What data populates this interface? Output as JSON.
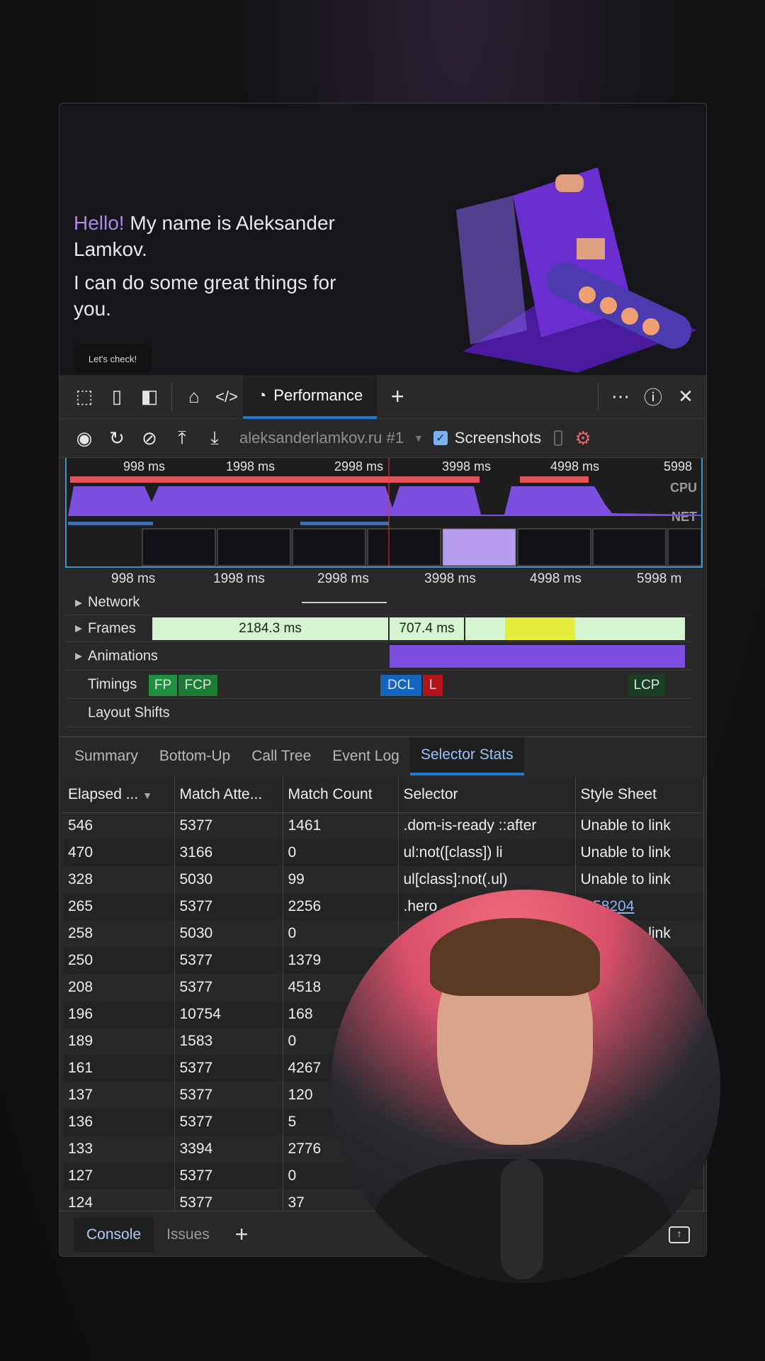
{
  "page": {
    "hello": "Hello!",
    "intro": " My name is Aleksander Lamkov.",
    "tagline": "I can do some great things for you.",
    "cta": "Let's check!"
  },
  "toolbar": {
    "active_tab": "Performance",
    "icons": [
      "inspect-icon",
      "device-icon",
      "dock-icon",
      "home-icon",
      "elements-icon",
      "performance-icon",
      "add-icon",
      "more-icon",
      "help-icon",
      "close-icon"
    ]
  },
  "controls": {
    "profile": "aleksanderlamkov.ru #1",
    "screenshots_label": "Screenshots",
    "screenshots_checked": true
  },
  "overview": {
    "ticks": [
      "998 ms",
      "1998 ms",
      "2998 ms",
      "3998 ms",
      "4998 ms",
      "5998"
    ],
    "cpu_label": "CPU",
    "net_label": "NET"
  },
  "ruler": [
    "998 ms",
    "1998 ms",
    "2998 ms",
    "3998 ms",
    "4998 ms",
    "5998 m"
  ],
  "tracks": {
    "network": "Network",
    "frames": "Frames",
    "frame1": "2184.3 ms",
    "frame2": "707.4 ms",
    "animations": "Animations",
    "timings": "Timings",
    "fp": "FP",
    "fcp": "FCP",
    "dcl": "DCL",
    "l": "L",
    "lcp": "LCP",
    "layout_shifts": "Layout Shifts"
  },
  "tabs": [
    "Summary",
    "Bottom-Up",
    "Call Tree",
    "Event Log",
    "Selector Stats"
  ],
  "table": {
    "headers": [
      "Elapsed ...",
      "Match Atte...",
      "Match Count",
      "Selector",
      "Style Sheet"
    ],
    "rows": [
      [
        "546",
        "5377",
        "1461",
        ".dom-is-ready ::after",
        "Unable to link"
      ],
      [
        "470",
        "3166",
        "0",
        "ul:not([class]) li",
        "Unable to link"
      ],
      [
        "328",
        "5030",
        "99",
        "ul[class]:not(.ul)",
        "Unable to link"
      ],
      [
        "265",
        "5377",
        "2256",
        ".hero",
        "1:58204"
      ],
      [
        "258",
        "5030",
        "0",
        "",
        "Unable to link"
      ],
      [
        "250",
        "5377",
        "1379",
        "",
        "Unable to link"
      ],
      [
        "208",
        "5377",
        "4518",
        "",
        ""
      ],
      [
        "196",
        "10754",
        "168",
        "",
        ""
      ],
      [
        "189",
        "1583",
        "0",
        "",
        ""
      ],
      [
        "161",
        "5377",
        "4267",
        "",
        ""
      ],
      [
        "137",
        "5377",
        "120",
        "",
        ""
      ],
      [
        "136",
        "5377",
        "5",
        "",
        ""
      ],
      [
        "133",
        "3394",
        "2776",
        "",
        ""
      ],
      [
        "127",
        "5377",
        "0",
        "",
        ""
      ],
      [
        "124",
        "5377",
        "37",
        "",
        ""
      ]
    ]
  },
  "drawer": {
    "tabs": [
      "Console",
      "Issues"
    ]
  },
  "colors": {
    "accent": "#1e7bd3",
    "cpu": "#7b4ee0",
    "fp": "#1e8f3e",
    "dcl": "#1565c0",
    "load": "#b3141b"
  }
}
